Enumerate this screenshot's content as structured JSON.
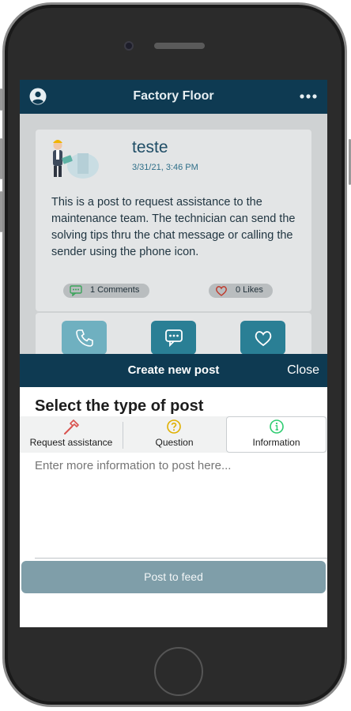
{
  "app": {
    "title": "Factory Floor"
  },
  "post": {
    "author": "teste",
    "date": "3/31/21, 3:46 PM",
    "body": "This is a post to request assistance to the maintenance team. The technician can send the solving tips thru the chat message or calling the sender using the phone icon.",
    "comments_label": "1 Comments",
    "likes_label": "0 Likes"
  },
  "sheet": {
    "title": "Create new post",
    "close_label": "Close",
    "select_heading": "Select the type of post",
    "types": [
      {
        "label": "Request assistance",
        "icon": "hammer-icon",
        "color": "#d9534f"
      },
      {
        "label": "Question",
        "icon": "question-circle-icon",
        "color": "#e0b000"
      },
      {
        "label": "Information",
        "icon": "info-circle-icon",
        "color": "#2ecc71"
      }
    ],
    "selected_type": "Information",
    "input_placeholder": "Enter more information to post here...",
    "submit_label": "Post to feed"
  },
  "colors": {
    "header": "#0e3a52",
    "action_teal": "#2a7f95",
    "submit_button": "#7f9ea9"
  }
}
